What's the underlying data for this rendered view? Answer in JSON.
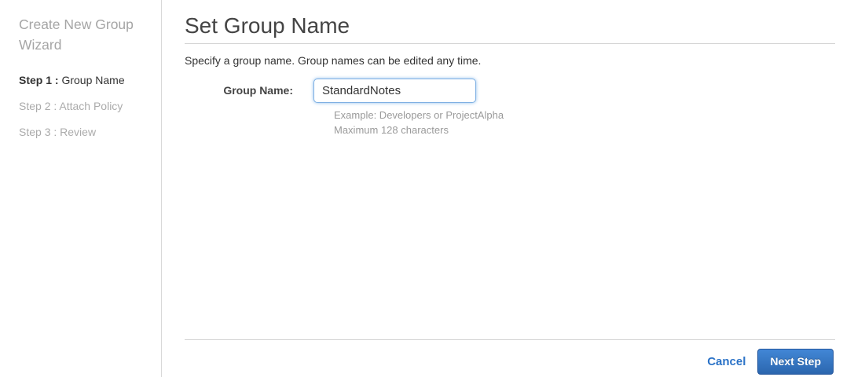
{
  "sidebar": {
    "title": "Create New Group Wizard",
    "steps": [
      {
        "prefix": "Step 1 :",
        "label": " Group Name"
      },
      {
        "prefix": "Step 2 :",
        "label": " Attach Policy"
      },
      {
        "prefix": "Step 3 :",
        "label": " Review"
      }
    ]
  },
  "main": {
    "title": "Set Group Name",
    "description": "Specify a group name. Group names can be edited any time.",
    "form": {
      "group_name_label": "Group Name:",
      "group_name_value": "StandardNotes",
      "hint_example": "Example: Developers or ProjectAlpha",
      "hint_max": "Maximum 128 characters"
    },
    "footer": {
      "cancel_label": "Cancel",
      "next_label": "Next Step"
    }
  },
  "colors": {
    "accent_blue": "#2a72c7",
    "button_gradient_top": "#4287d6",
    "button_gradient_bottom": "#2b66ae",
    "input_focus_border": "#7fb0e3"
  }
}
